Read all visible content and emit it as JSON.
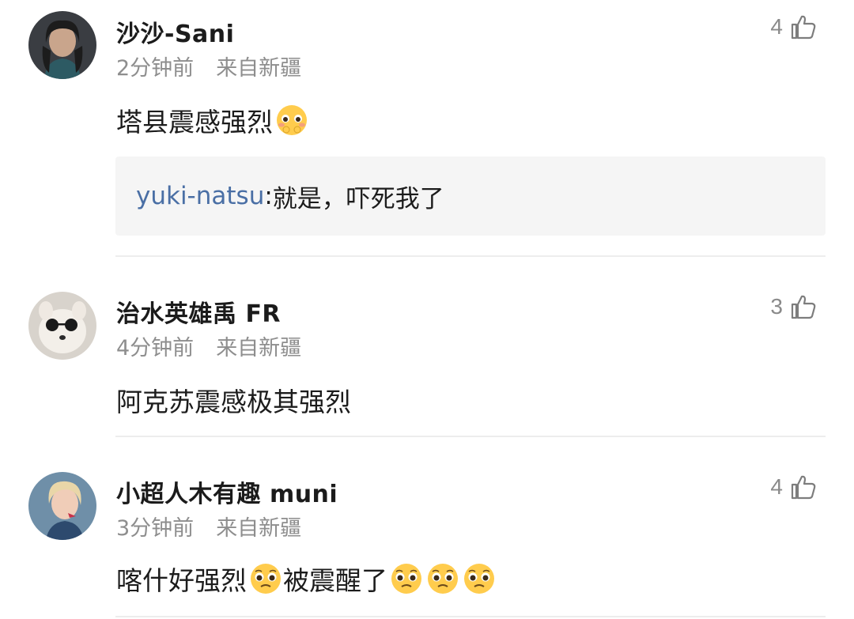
{
  "comments": [
    {
      "username": "沙沙-Sani",
      "time": "2分钟前",
      "location": "来自新疆",
      "text": "塔县震感强烈",
      "likes": "4",
      "emojis": [
        "blushing-shy-emoji"
      ],
      "reply": {
        "user": "yuki-natsu",
        "separator": ": ",
        "text": "就是，吓死我了"
      }
    },
    {
      "username": "治水英雄禹 FR",
      "time": "4分钟前",
      "location": "来自新疆",
      "text": "阿克苏震感极其强烈",
      "likes": "3",
      "emojis": []
    },
    {
      "username": "小超人木有趣 muni",
      "time": "3分钟前",
      "location": "来自新疆",
      "text_before": "喀什好强烈",
      "text_after": "被震醒了",
      "likes": "4",
      "emojis": [
        "pleading-face-emoji",
        "pleading-face-emoji",
        "pleading-face-emoji",
        "pleading-face-emoji"
      ]
    }
  ],
  "icons": {
    "like": "thumbs-up-outline-icon"
  },
  "colors": {
    "reply_user": "#4a6fa5",
    "meta": "#8e8e8e",
    "reply_bg": "#f5f5f5"
  }
}
